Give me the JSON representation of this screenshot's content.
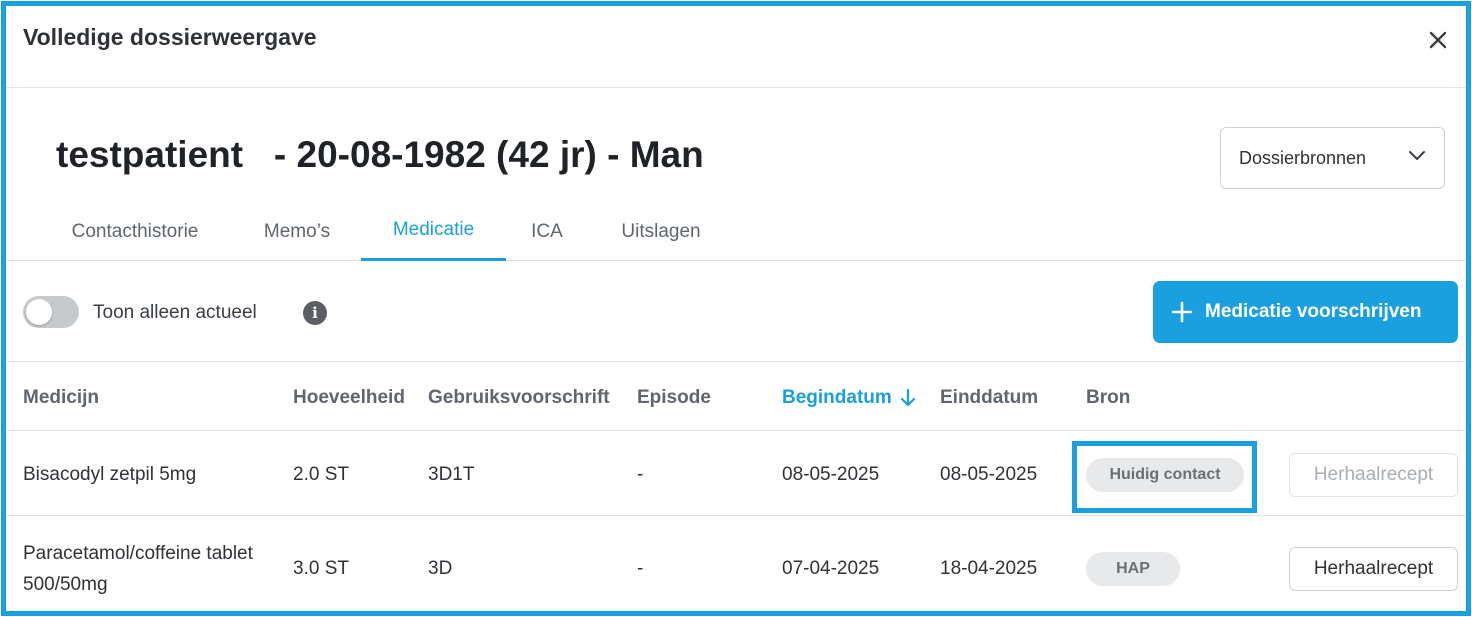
{
  "modal": {
    "title": "Volledige dossierweergave"
  },
  "patient": {
    "header": "testpatient   - 20-08-1982 (42 jr) - Man"
  },
  "sources_dropdown": {
    "label": "Dossierbronnen"
  },
  "tabs": [
    {
      "label": "Contacthistorie",
      "active": false
    },
    {
      "label": "Memo’s",
      "active": false
    },
    {
      "label": "Medicatie",
      "active": true
    },
    {
      "label": "ICA",
      "active": false
    },
    {
      "label": "Uitslagen",
      "active": false
    }
  ],
  "toolbar": {
    "toggle_label": "Toon alleen actueel",
    "toggle_on": false,
    "info_icon": "info-icon",
    "prescribe_label": "Medicatie voorschrijven"
  },
  "table": {
    "columns": [
      "Medicijn",
      "Hoeveelheid",
      "Gebruiksvoorschrift",
      "Episode",
      "Begindatum",
      "Einddatum",
      "Bron"
    ],
    "sorted_column": "Begindatum",
    "sort_direction": "descending",
    "rows": [
      {
        "medicijn": "Bisacodyl zetpil 5mg",
        "hoeveelheid": "2.0 ST",
        "gebruiksvoorschrift": "3D1T",
        "episode": "-",
        "begindatum": "08-05-2025",
        "einddatum": "08-05-2025",
        "bron": "Huidig contact",
        "action": "Herhaalrecept",
        "action_enabled": false,
        "highlighted": true
      },
      {
        "medicijn": "Paracetamol/coffeine tablet 500/50mg",
        "hoeveelheid": "3.0 ST",
        "gebruiksvoorschrift": "3D",
        "episode": "-",
        "begindatum": "07-04-2025",
        "einddatum": "18-04-2025",
        "bron": "HAP",
        "action": "Herhaalrecept",
        "action_enabled": true,
        "highlighted": false
      }
    ]
  },
  "colors": {
    "accent": "#1aa0de",
    "highlight_border": "#1aa0de",
    "badge_bg": "#e7e9eb"
  }
}
